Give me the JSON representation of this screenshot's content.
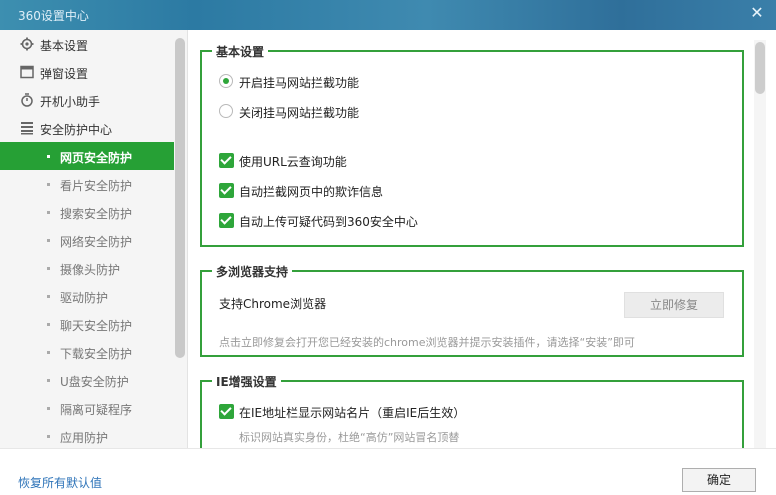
{
  "window": {
    "title": "360设置中心",
    "close_glyph": "✕"
  },
  "sidebar": {
    "main_items": [
      {
        "label": "基本设置",
        "icon": "gear-icon"
      },
      {
        "label": "弹窗设置",
        "icon": "window-icon"
      },
      {
        "label": "开机小助手",
        "icon": "power-timer-icon"
      },
      {
        "label": "安全防护中心",
        "icon": "shield-grid-icon"
      }
    ],
    "sub_items": [
      {
        "label": "网页安全防护",
        "active": true
      },
      {
        "label": "看片安全防护"
      },
      {
        "label": "搜索安全防护"
      },
      {
        "label": "网络安全防护"
      },
      {
        "label": "摄像头防护"
      },
      {
        "label": "驱动防护"
      },
      {
        "label": "聊天安全防护"
      },
      {
        "label": "下载安全防护"
      },
      {
        "label": "U盘安全防护"
      },
      {
        "label": "隔离可疑程序"
      },
      {
        "label": "应用防护"
      }
    ]
  },
  "basic": {
    "title": "基本设置",
    "radios": [
      {
        "label": "开启挂马网站拦截功能",
        "checked": true
      },
      {
        "label": "关闭挂马网站拦截功能",
        "checked": false
      }
    ],
    "checks": [
      {
        "label": "使用URL云查询功能",
        "checked": true
      },
      {
        "label": "自动拦截网页中的欺诈信息",
        "checked": true
      },
      {
        "label": "自动上传可疑代码到360安全中心",
        "checked": true
      }
    ]
  },
  "multi_browser": {
    "title": "多浏览器支持",
    "support_label": "支持Chrome浏览器",
    "repair_button": "立即修复",
    "hint": "点击立即修复会打开您已经安装的chrome浏览器并提示安装插件，请选择“安装”即可"
  },
  "ie": {
    "title": "IE增强设置",
    "check_label": "在IE地址栏显示网站名片（重启IE后生效）",
    "hint": "标识网站真实身份，杜绝“高仿”网站冒名顶替"
  },
  "footer": {
    "restore_link": "恢复所有默认值",
    "ok_button": "确定"
  },
  "colors": {
    "accent": "#2ea63a",
    "active_bg": "#26a035",
    "link": "#2d73b8",
    "titlebar": "#2c7aa3"
  }
}
